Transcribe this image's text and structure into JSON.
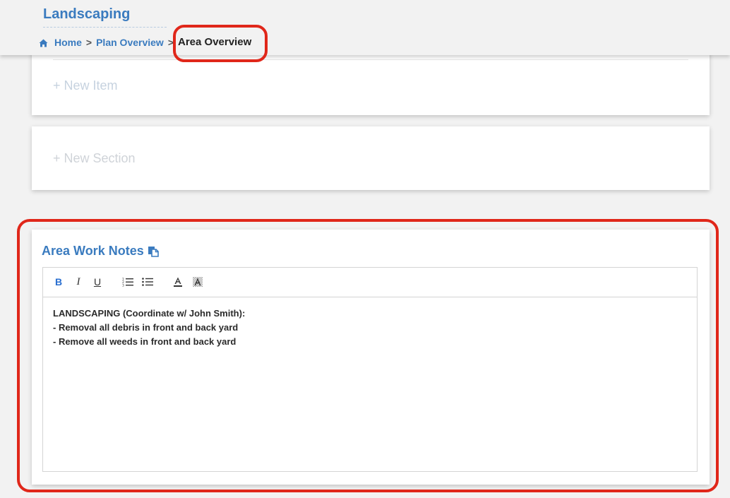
{
  "header": {
    "title": "Landscaping",
    "breadcrumb": {
      "home_label": "Home",
      "plan_label": "Plan Overview",
      "current_label": "Area Overview",
      "separator": ">"
    }
  },
  "cards": {
    "new_item_label": "+ New Item",
    "new_section_label": "+ New Section"
  },
  "notes": {
    "title": "Area Work Notes",
    "toolbar": {
      "bold": "B",
      "italic": "I",
      "underline": "U"
    },
    "lines": [
      "LANDSCAPING (Coordinate w/ John Smith):",
      "- Removal all debris in front and back yard",
      "- Remove all weeds in front and back yard"
    ]
  },
  "colors": {
    "accent": "#3a7bbf",
    "annotation": "#e0271a",
    "background": "#f2f2f2"
  },
  "icons": {
    "home": "home-icon",
    "copy": "copy-icon",
    "ordered_list": "ordered-list-icon",
    "unordered_list": "unordered-list-icon",
    "text_color": "text-color-icon",
    "highlight": "highlight-icon"
  }
}
